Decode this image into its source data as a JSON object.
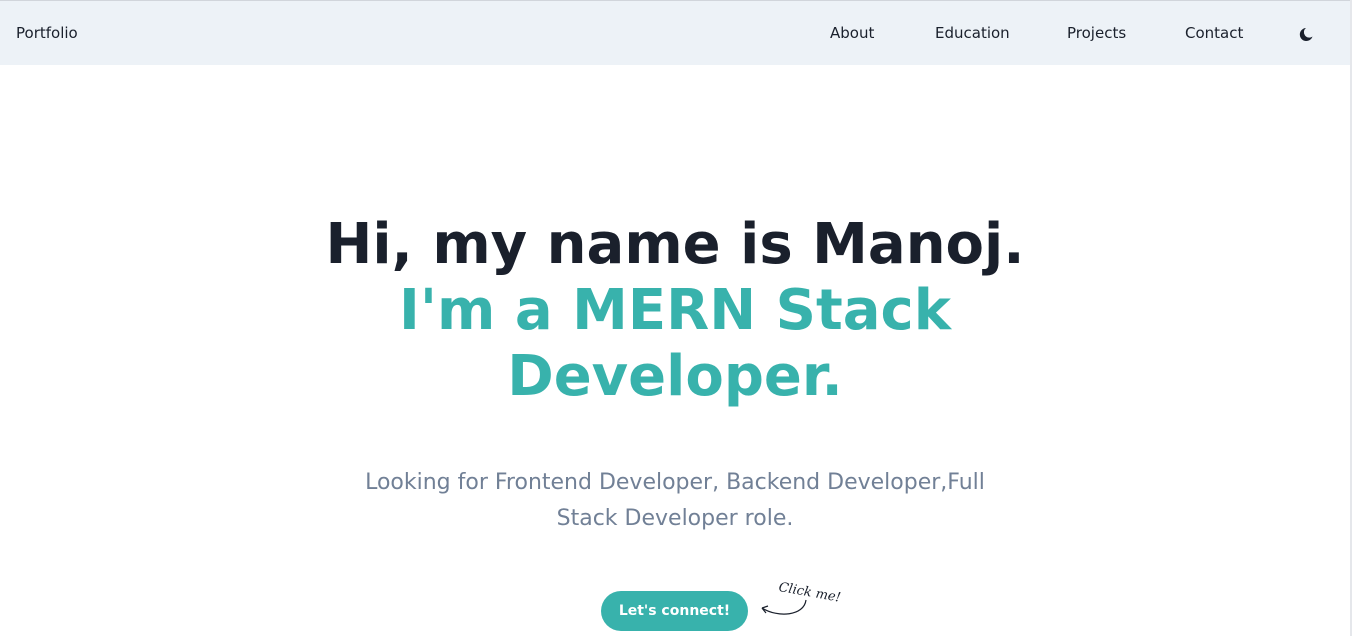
{
  "navbar": {
    "brand": "Portfolio",
    "links": [
      "About",
      "Education",
      "Projects",
      "Contact"
    ],
    "theme_icon": "moon-icon"
  },
  "hero": {
    "line1": "Hi, my name is Manoj.",
    "line2": "I'm a MERN Stack Developer.",
    "subtitle": "Looking for Frontend Developer, Backend Developer,Full Stack Developer role.",
    "cta_label": "Let's connect!",
    "annotation": "Click me!"
  },
  "colors": {
    "accent": "#38b2ac",
    "nav_background": "#edf2f7",
    "heading": "#1a202c",
    "subtitle": "#718096"
  }
}
